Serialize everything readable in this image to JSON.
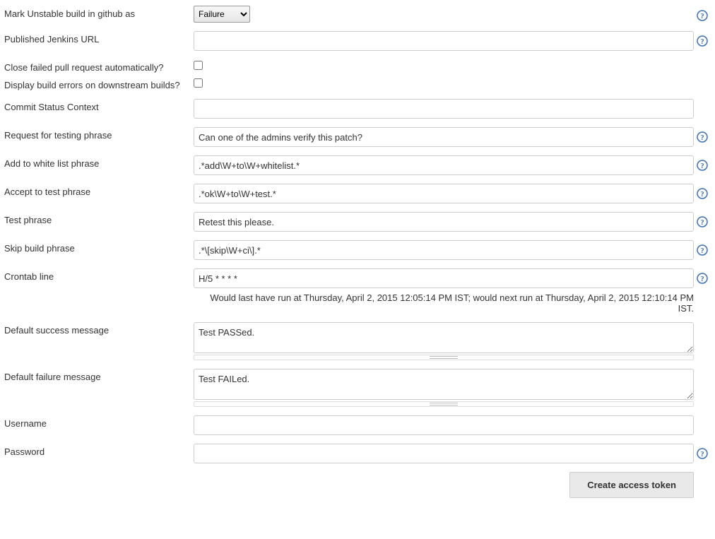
{
  "labels": {
    "mark_unstable": "Mark Unstable build in github as",
    "published_url": "Published Jenkins URL",
    "close_failed": "Close failed pull request automatically?",
    "display_errors": "Display build errors on downstream builds?",
    "commit_context": "Commit Status Context",
    "request_testing": "Request for testing phrase",
    "whitelist": "Add to white list phrase",
    "accept_test": "Accept to test phrase",
    "test_phrase": "Test phrase",
    "skip_build": "Skip build phrase",
    "crontab": "Crontab line",
    "success_msg": "Default success message",
    "failure_msg": "Default failure message",
    "username": "Username",
    "password": "Password"
  },
  "values": {
    "mark_unstable_selected": "Failure",
    "published_url": "",
    "commit_context": "",
    "request_testing": "Can one of the admins verify this patch?",
    "whitelist": ".*add\\W+to\\W+whitelist.*",
    "accept_test": ".*ok\\W+to\\W+test.*",
    "test_phrase": "Retest this please.",
    "skip_build": ".*\\[skip\\W+ci\\].*",
    "crontab": "H/5 * * * *",
    "crontab_hint": "Would last have run at Thursday, April 2, 2015 12:05:14 PM IST; would next run at Thursday, April 2, 2015 12:10:14 PM IST.",
    "success_msg": "Test PASSed.",
    "failure_msg": "Test FAILed.",
    "username": "",
    "password": ""
  },
  "buttons": {
    "create_token": "Create access token"
  }
}
